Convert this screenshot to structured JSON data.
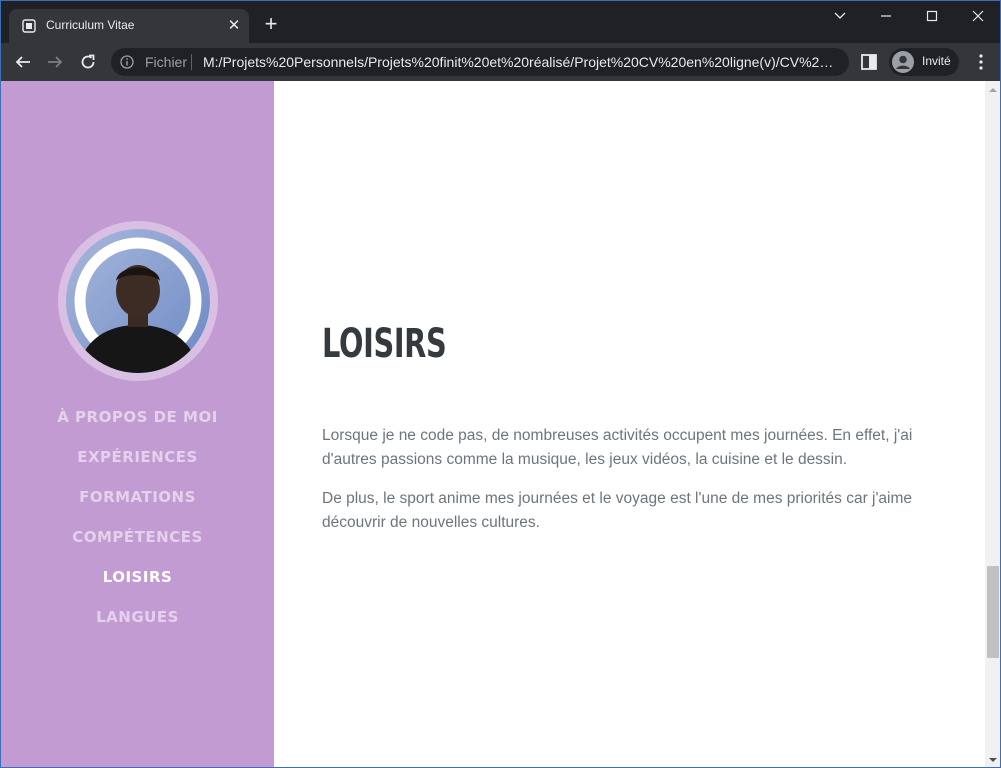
{
  "browser": {
    "tab": {
      "title": "Curriculum Vitae",
      "close_label": "✕"
    },
    "new_tab_label": "+",
    "address": {
      "scheme_label": "Fichier",
      "url": "M:/Projets%20Personnels/Projets%20finit%20et%20réalisé/Projet%20CV%20en%20ligne(v)/CV%20e..."
    },
    "profile_label": "Invité"
  },
  "sidebar": {
    "nav": [
      {
        "label": "À PROPOS DE MOI",
        "active": false
      },
      {
        "label": "EXPÉRIENCES",
        "active": false
      },
      {
        "label": "FORMATIONS",
        "active": false
      },
      {
        "label": "COMPÉTENCES",
        "active": false
      },
      {
        "label": "LOISIRS",
        "active": true
      },
      {
        "label": "LANGUES",
        "active": false
      }
    ]
  },
  "main": {
    "heading": "LOISIRS",
    "paragraphs": [
      "Lorsque je ne code pas, de nombreuses activités occupent mes journées. En effet, j'ai d'autres passions comme la musique, les jeux vidéos, la cuisine et le dessin.",
      "De plus, le sport anime mes journées et le voyage est l'une de mes priorités car j'aime découvrir de nouvelles cultures."
    ]
  },
  "colors": {
    "sidebar_bg": "#c39bd3",
    "heading": "#343a40",
    "body_text": "#6c757d"
  }
}
